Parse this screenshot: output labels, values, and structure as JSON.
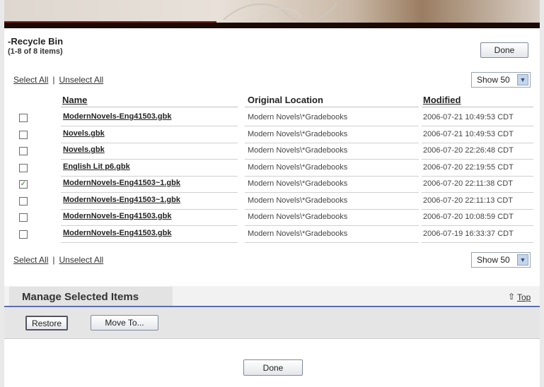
{
  "banner": {
    "text": ""
  },
  "header": {
    "title": "Recycle Bin",
    "count": "(1-8 of 8 items)",
    "done_label": "Done"
  },
  "selection": {
    "select_all": "Select All",
    "separator": "|",
    "unselect_all": "Unselect All"
  },
  "show": {
    "value": "Show 50"
  },
  "table": {
    "columns": [
      "Name",
      "Original Location",
      "Modified"
    ],
    "rows": [
      {
        "checked": false,
        "name": "ModernNovels-Eng41503.gbk",
        "location": "Modern Novels\\*Gradebooks",
        "modified": "2006-07-21 10:49:53 CDT"
      },
      {
        "checked": false,
        "name": "Novels.gbk",
        "location": "Modern Novels\\*Gradebooks",
        "modified": "2006-07-21 10:49:53 CDT"
      },
      {
        "checked": false,
        "name": "Novels.gbk",
        "location": "Modern Novels\\*Gradebooks",
        "modified": "2006-07-20 22:26:48 CDT"
      },
      {
        "checked": false,
        "name": "English Lit p6.gbk",
        "location": "Modern Novels\\*Gradebooks",
        "modified": "2006-07-20 22:19:55 CDT"
      },
      {
        "checked": true,
        "name": "ModernNovels-Eng41503~1.gbk",
        "location": "Modern Novels\\*Gradebooks",
        "modified": "2006-07-20 22:11:38 CDT"
      },
      {
        "checked": false,
        "name": "ModernNovels-Eng41503~1.gbk",
        "location": "Modern Novels\\*Gradebooks",
        "modified": "2006-07-20 22:11:13 CDT"
      },
      {
        "checked": false,
        "name": "ModernNovels-Eng41503.gbk",
        "location": "Modern Novels\\*Gradebooks",
        "modified": "2006-07-20 10:08:59 CDT"
      },
      {
        "checked": false,
        "name": "ModernNovels-Eng41503.gbk",
        "location": "Modern Novels\\*Gradebooks",
        "modified": "2006-07-19 16:33:37 CDT"
      }
    ]
  },
  "manage": {
    "title": "Manage Selected Items",
    "top_link": "Top",
    "restore_label": "Restore",
    "move_label": "Move To..."
  },
  "footer": {
    "done_label": "Done"
  },
  "colors": {
    "accent_line": "#5a6fb0",
    "banner_dark": "#1a0a06",
    "banner_red": "#7a1e14"
  }
}
